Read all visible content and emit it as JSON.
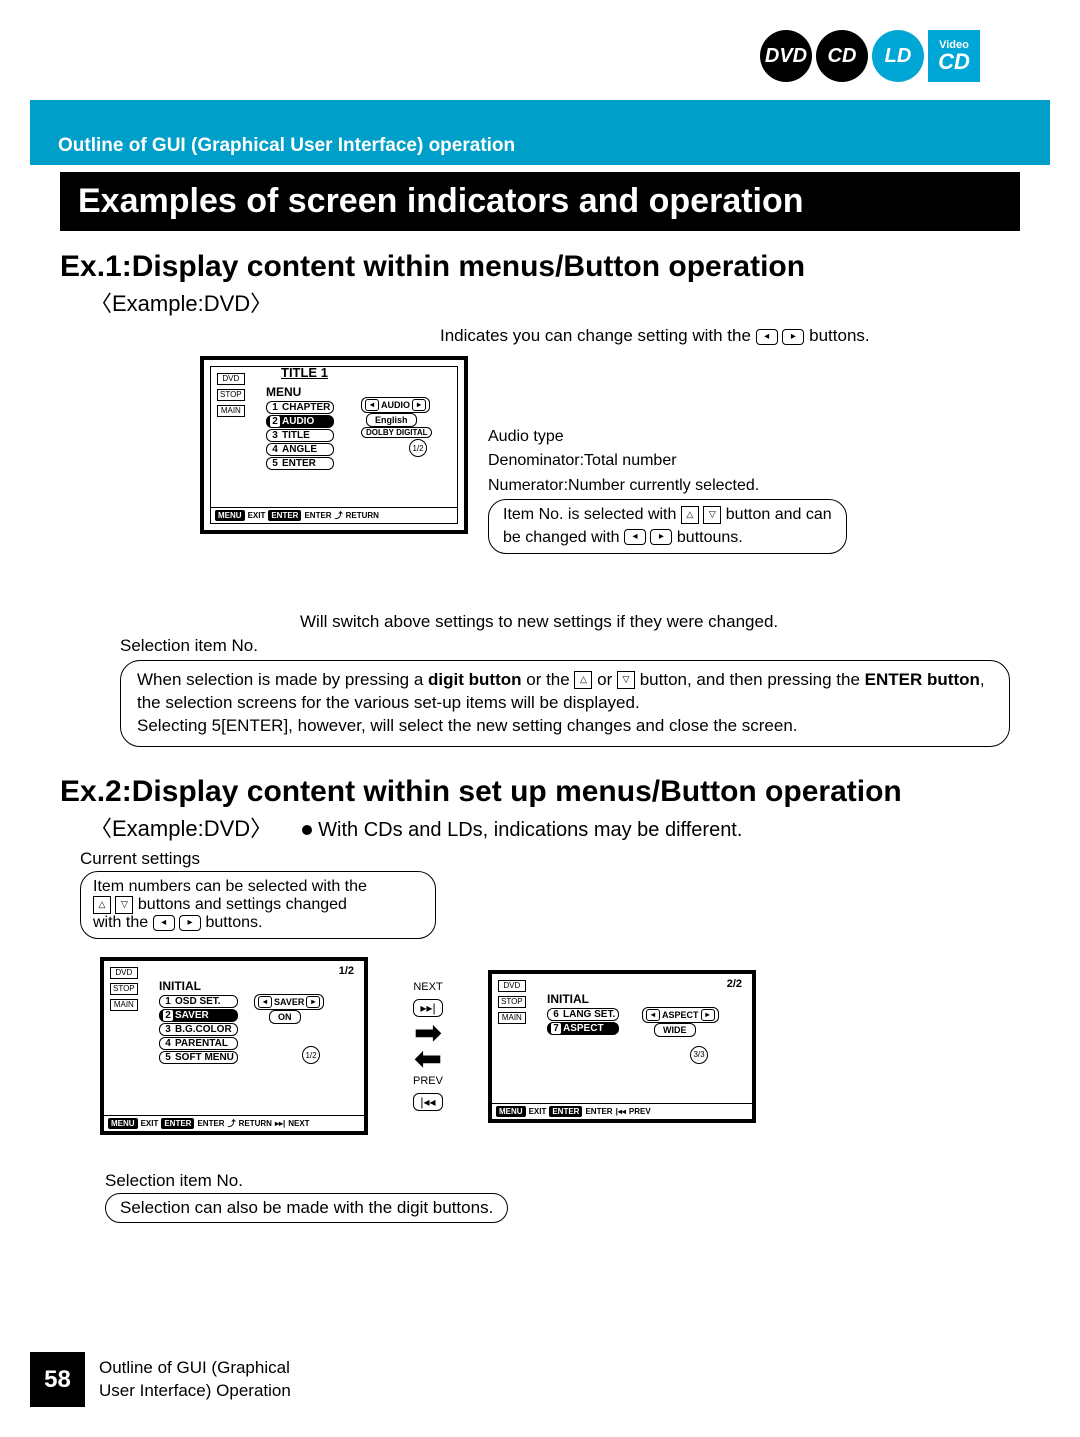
{
  "logos": {
    "dvd": "DVD",
    "cd": "CD",
    "ld": "LD",
    "vcd_top": "Video",
    "vcd_bottom": "CD"
  },
  "header": {
    "breadcrumb": "Outline of GUI (Graphical User Interface) operation"
  },
  "title": "Examples of screen indicators and operation",
  "ex1": {
    "heading": "Ex.1:Display content within menus/Button operation",
    "sub": "〈Example:DVD〉",
    "topnote_a": "Indicates you can change setting with the",
    "topnote_b": "buttons.",
    "screen": {
      "title": "TITLE 1",
      "menu": "MENU",
      "items": [
        {
          "n": "1",
          "l": "CHAPTER"
        },
        {
          "n": "2",
          "l": "AUDIO"
        },
        {
          "n": "3",
          "l": "TITLE"
        },
        {
          "n": "4",
          "l": "ANGLE"
        },
        {
          "n": "5",
          "l": "ENTER"
        }
      ],
      "audio": "AUDIO",
      "english": "English",
      "dolby": "DOLBY DIGITAL",
      "frac": "1/2",
      "side": {
        "dvd": "DVD",
        "stop": "STOP",
        "main": "MAIN"
      },
      "foot": {
        "menu": "MENU",
        "exit": "EXIT",
        "enter_tag": "ENTER",
        "enter": "ENTER",
        "return": "RETURN"
      }
    },
    "callouts": {
      "audio_type": "Audio type",
      "denom": "Denominator:Total number",
      "numer": "Numerator:Number currently selected.",
      "itemno_a": "Item No. is selected with",
      "itemno_b": "button and can",
      "itemno_c": "be changed with",
      "itemno_d": "buttouns."
    },
    "switch": "Will switch above settings to new settings if they were changed.",
    "sel": "Selection item No.",
    "bigbox_a": "When selection is made by pressing a ",
    "bigbox_b": "digit button",
    "bigbox_c": " or the ",
    "bigbox_d": " or ",
    "bigbox_e": " button, and then pressing the ",
    "bigbox_f": "ENTER button",
    "bigbox_g": ", the selection screens for the various set-up items will be displayed.",
    "bigbox_h": "Selecting 5[ENTER], however, will select the new setting changes and close the screen."
  },
  "ex2": {
    "heading": "Ex.2:Display content within set up menus/Button operation",
    "sub": "〈Example:DVD〉",
    "bullet": "With CDs and LDs, indications may be different.",
    "cs_label": "Current settings",
    "cs_box_a": "Item numbers can be selected with the",
    "cs_box_b": "buttons and settings changed",
    "cs_box_c": "with the",
    "cs_box_d": "buttons.",
    "s2": {
      "hdr": "INITIAL",
      "page": "1/2",
      "items": [
        {
          "n": "1",
          "l": "OSD SET."
        },
        {
          "n": "2",
          "l": "SAVER"
        },
        {
          "n": "3",
          "l": "B.G.COLOR"
        },
        {
          "n": "4",
          "l": "PARENTAL"
        },
        {
          "n": "5",
          "l": "SOFT MENU"
        }
      ],
      "opt": "SAVER",
      "val": "ON",
      "frac": "1/2",
      "foot": {
        "menu": "MENU",
        "exit": "EXIT",
        "enter_tag": "ENTER",
        "enter": "ENTER",
        "return": "RETURN",
        "next": "NEXT"
      }
    },
    "mid": {
      "next": "NEXT",
      "prev": "PREV"
    },
    "s3": {
      "hdr": "INITIAL",
      "page": "2/2",
      "items": [
        {
          "n": "6",
          "l": "LANG SET."
        },
        {
          "n": "7",
          "l": "ASPECT"
        }
      ],
      "opt": "ASPECT",
      "val": "WIDE",
      "frac": "3/3",
      "foot": {
        "menu": "MENU",
        "exit": "EXIT",
        "enter_tag": "ENTER",
        "enter": "ENTER",
        "prev": "PREV"
      }
    },
    "sel": "Selection item No.",
    "digit": "Selection can also be made with the digit buttons."
  },
  "footer": {
    "page": "58",
    "l1": "Outline of GUI (Graphical",
    "l2": "User Interface) Operation"
  }
}
